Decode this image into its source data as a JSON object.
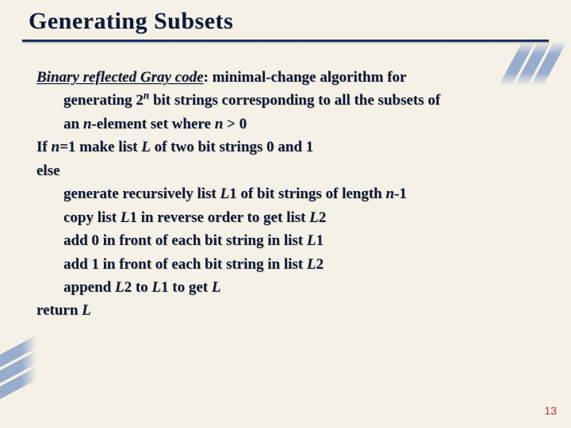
{
  "slide": {
    "title": "Generating Subsets",
    "page_number": "13",
    "body": {
      "brgc_term": "Binary reflected Gray code",
      "intro_pre": ": minimal-change algorithm for",
      "intro_gen_a": "generating 2",
      "intro_gen_exp": "n",
      "intro_gen_b": " bit strings corresponding to all the subsets of",
      "intro_set_a": "an ",
      "intro_set_n": "n",
      "intro_set_b": "-element set where ",
      "intro_set_n2": "n",
      "intro_set_c": " > 0",
      "if_a": "If ",
      "if_n": "n",
      "if_b": "=1 make list ",
      "if_L": "L",
      "if_c": " of two bit strings 0 and 1",
      "else": "else",
      "gen_a": "generate recursively list ",
      "gen_L1": "L",
      "gen_b": "1 of bit strings of length ",
      "gen_n": "n",
      "gen_c": "-1",
      "copy_a": "copy list ",
      "copy_L1": "L",
      "copy_b": "1 in reverse order to get list ",
      "copy_L2": "L",
      "copy_c": "2",
      "add0_a": "add 0 in front of each bit string in list ",
      "add0_L1": "L",
      "add0_b": "1",
      "add1_a": "add 1 in front of each bit string in list ",
      "add1_L2": "L",
      "add1_b": "2",
      "append_a": "append ",
      "append_L2": "L",
      "append_b": "2 to ",
      "append_L1": "L",
      "append_c": "1 to get ",
      "append_L": "L",
      "return_a": "return ",
      "return_L": "L"
    }
  }
}
